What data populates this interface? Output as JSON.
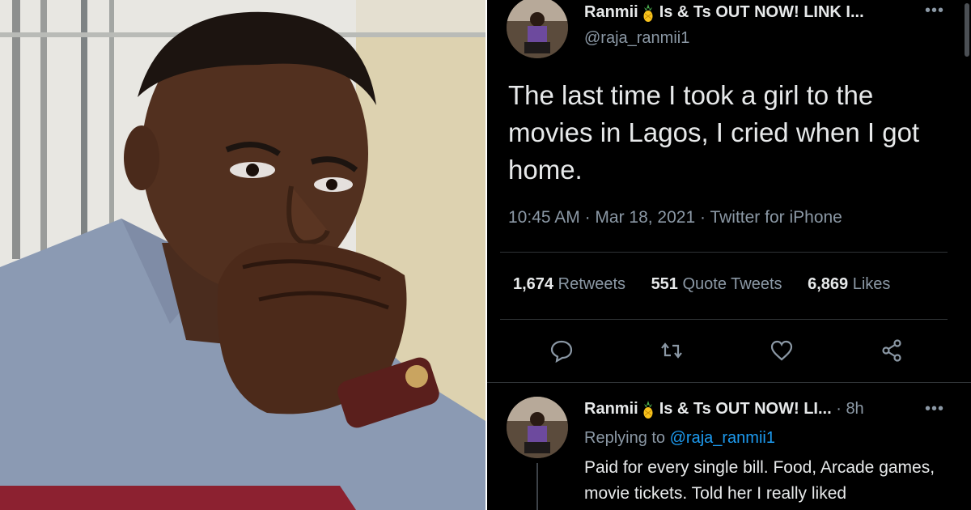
{
  "photo": {
    "description_icon": "man-portrait-photo"
  },
  "tweet": {
    "display_name": "Ranmii",
    "name_suffix": "Is & Ts OUT NOW! LINK I...",
    "handle": "@raja_ranmii1",
    "text": "The last time I took a girl to the movies in Lagos, I cried when I got home.",
    "time": "10:45 AM",
    "date": "Mar 18, 2021",
    "source": "Twitter for iPhone",
    "retweets_count": "1,674",
    "retweets_label": "Retweets",
    "quotes_count": "551",
    "quotes_label": "Quote Tweets",
    "likes_count": "6,869",
    "likes_label": "Likes",
    "more_label": "•••",
    "emoji": "pineapple-icon"
  },
  "reply": {
    "display_name": "Ranmii",
    "name_suffix": "Is & Ts OUT NOW! LI...",
    "age": "8h",
    "replying_prefix": "Replying to",
    "replying_to": "@raja_ranmii1",
    "text": "Paid for every single bill. Food, Arcade games, movie tickets. Told her I really liked",
    "more_label": "•••"
  },
  "colors": {
    "background": "#000000",
    "text": "#e7e9ea",
    "muted": "#8b98a5",
    "accent": "#1d9bf0",
    "divider": "#2f3336"
  }
}
